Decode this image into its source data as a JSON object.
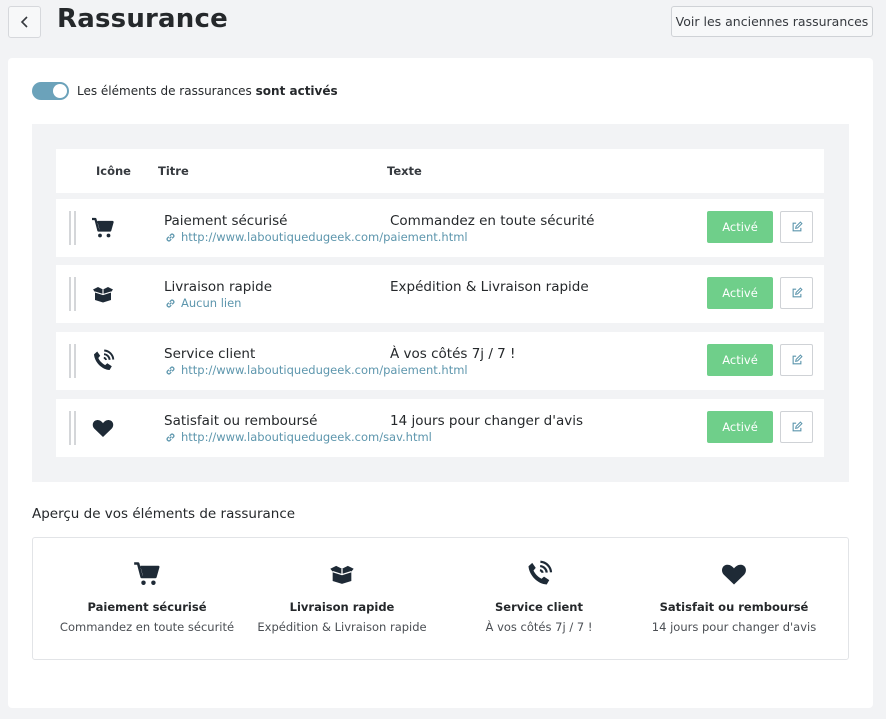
{
  "header": {
    "title": "Rassurance",
    "old_button": "Voir les anciennes rassurances",
    "back_icon": "chevron-left-icon"
  },
  "toggle": {
    "label_prefix": "Les éléments de rassurances",
    "label_bold": "sont activés",
    "state": "on",
    "color": "#6ba2ba"
  },
  "table": {
    "headers": {
      "icon": "Icône",
      "title": "Titre",
      "text": "Texte"
    },
    "rows": [
      {
        "icon": "shopping-cart-icon",
        "title": "Paiement sécurisé",
        "link": "http://www.laboutiquedugeek.com/paiement.html",
        "text": "Commandez en toute sécurité",
        "status": "Activé"
      },
      {
        "icon": "open-box-icon",
        "title": "Livraison rapide",
        "link": "Aucun lien",
        "text": "Expédition & Livraison rapide",
        "status": "Activé"
      },
      {
        "icon": "phone-volume-icon",
        "title": "Service client",
        "link": "http://www.laboutiquedugeek.com/paiement.html",
        "text": "À vos côtés 7j / 7 !",
        "status": "Activé"
      },
      {
        "icon": "heart-icon",
        "title": "Satisfait ou remboursé",
        "link": "http://www.laboutiquedugeek.com/sav.html",
        "text": "14 jours pour changer d'avis",
        "status": "Activé"
      }
    ]
  },
  "preview": {
    "title": "Aperçu de vos éléments de rassurance",
    "items": [
      {
        "icon": "shopping-cart-icon",
        "title": "Paiement sécurisé",
        "text": "Commandez en toute sécurité"
      },
      {
        "icon": "open-box-icon",
        "title": "Livraison rapide",
        "text": "Expédition & Livraison rapide"
      },
      {
        "icon": "phone-volume-icon",
        "title": "Service client",
        "text": "À vos côtés 7j / 7 !"
      },
      {
        "icon": "heart-icon",
        "title": "Satisfait ou remboursé",
        "text": "14 jours pour changer d'avis"
      }
    ]
  },
  "colors": {
    "status_active": "#6fcf8a",
    "link": "#5d96ad",
    "icon": "#1e2a36"
  }
}
